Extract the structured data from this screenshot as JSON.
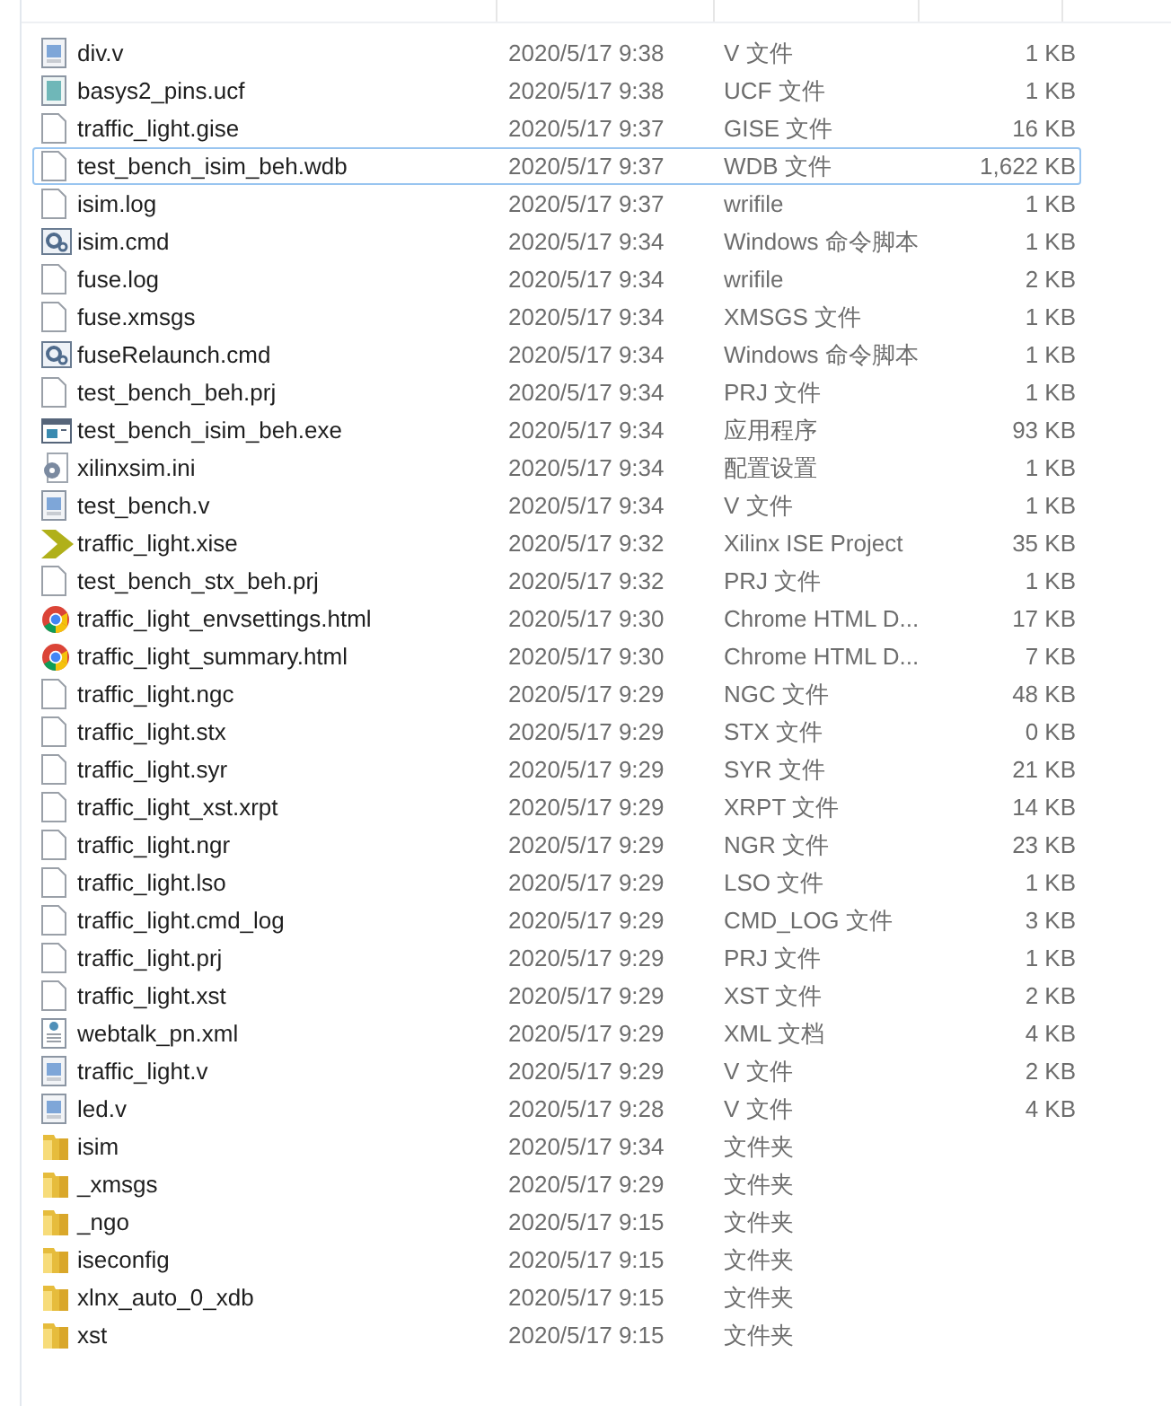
{
  "files": [
    {
      "kind": "source",
      "name": "div.v",
      "date": "2020/5/17 9:38",
      "type": "V 文件",
      "size": "1 KB",
      "selected": false
    },
    {
      "kind": "text",
      "name": "basys2_pins.ucf",
      "date": "2020/5/17 9:38",
      "type": "UCF 文件",
      "size": "1 KB",
      "selected": false
    },
    {
      "kind": "blank",
      "name": "traffic_light.gise",
      "date": "2020/5/17 9:37",
      "type": "GISE 文件",
      "size": "16 KB",
      "selected": false
    },
    {
      "kind": "blank",
      "name": "test_bench_isim_beh.wdb",
      "date": "2020/5/17 9:37",
      "type": "WDB 文件",
      "size": "1,622 KB",
      "selected": true
    },
    {
      "kind": "blank",
      "name": "isim.log",
      "date": "2020/5/17 9:37",
      "type": "wrifile",
      "size": "1 KB",
      "selected": false
    },
    {
      "kind": "script",
      "name": "isim.cmd",
      "date": "2020/5/17 9:34",
      "type": "Windows 命令脚本",
      "size": "1 KB",
      "selected": false
    },
    {
      "kind": "blank",
      "name": "fuse.log",
      "date": "2020/5/17 9:34",
      "type": "wrifile",
      "size": "2 KB",
      "selected": false
    },
    {
      "kind": "blank",
      "name": "fuse.xmsgs",
      "date": "2020/5/17 9:34",
      "type": "XMSGS 文件",
      "size": "1 KB",
      "selected": false
    },
    {
      "kind": "script",
      "name": "fuseRelaunch.cmd",
      "date": "2020/5/17 9:34",
      "type": "Windows 命令脚本",
      "size": "1 KB",
      "selected": false
    },
    {
      "kind": "blank",
      "name": "test_bench_beh.prj",
      "date": "2020/5/17 9:34",
      "type": "PRJ 文件",
      "size": "1 KB",
      "selected": false
    },
    {
      "kind": "program",
      "name": "test_bench_isim_beh.exe",
      "date": "2020/5/17 9:34",
      "type": "应用程序",
      "size": "93 KB",
      "selected": false
    },
    {
      "kind": "settings",
      "name": "xilinxsim.ini",
      "date": "2020/5/17 9:34",
      "type": "配置设置",
      "size": "1 KB",
      "selected": false
    },
    {
      "kind": "source",
      "name": "test_bench.v",
      "date": "2020/5/17 9:34",
      "type": "V 文件",
      "size": "1 KB",
      "selected": false
    },
    {
      "kind": "project",
      "name": "traffic_light.xise",
      "date": "2020/5/17 9:32",
      "type": "Xilinx ISE Project",
      "size": "35 KB",
      "selected": false
    },
    {
      "kind": "blank",
      "name": "test_bench_stx_beh.prj",
      "date": "2020/5/17 9:32",
      "type": "PRJ 文件",
      "size": "1 KB",
      "selected": false
    },
    {
      "kind": "browser",
      "name": "traffic_light_envsettings.html",
      "date": "2020/5/17 9:30",
      "type": "Chrome HTML D...",
      "size": "17 KB",
      "selected": false
    },
    {
      "kind": "browser",
      "name": "traffic_light_summary.html",
      "date": "2020/5/17 9:30",
      "type": "Chrome HTML D...",
      "size": "7 KB",
      "selected": false
    },
    {
      "kind": "blank",
      "name": "traffic_light.ngc",
      "date": "2020/5/17 9:29",
      "type": "NGC 文件",
      "size": "48 KB",
      "selected": false
    },
    {
      "kind": "blank",
      "name": "traffic_light.stx",
      "date": "2020/5/17 9:29",
      "type": "STX 文件",
      "size": "0 KB",
      "selected": false
    },
    {
      "kind": "blank",
      "name": "traffic_light.syr",
      "date": "2020/5/17 9:29",
      "type": "SYR 文件",
      "size": "21 KB",
      "selected": false
    },
    {
      "kind": "blank",
      "name": "traffic_light_xst.xrpt",
      "date": "2020/5/17 9:29",
      "type": "XRPT 文件",
      "size": "14 KB",
      "selected": false
    },
    {
      "kind": "blank",
      "name": "traffic_light.ngr",
      "date": "2020/5/17 9:29",
      "type": "NGR 文件",
      "size": "23 KB",
      "selected": false
    },
    {
      "kind": "blank",
      "name": "traffic_light.lso",
      "date": "2020/5/17 9:29",
      "type": "LSO 文件",
      "size": "1 KB",
      "selected": false
    },
    {
      "kind": "blank",
      "name": "traffic_light.cmd_log",
      "date": "2020/5/17 9:29",
      "type": "CMD_LOG 文件",
      "size": "3 KB",
      "selected": false
    },
    {
      "kind": "blank",
      "name": "traffic_light.prj",
      "date": "2020/5/17 9:29",
      "type": "PRJ 文件",
      "size": "1 KB",
      "selected": false
    },
    {
      "kind": "blank",
      "name": "traffic_light.xst",
      "date": "2020/5/17 9:29",
      "type": "XST 文件",
      "size": "2 KB",
      "selected": false
    },
    {
      "kind": "xml",
      "name": "webtalk_pn.xml",
      "date": "2020/5/17 9:29",
      "type": "XML 文档",
      "size": "4 KB",
      "selected": false
    },
    {
      "kind": "source",
      "name": "traffic_light.v",
      "date": "2020/5/17 9:29",
      "type": "V 文件",
      "size": "2 KB",
      "selected": false
    },
    {
      "kind": "source",
      "name": "led.v",
      "date": "2020/5/17 9:28",
      "type": "V 文件",
      "size": "4 KB",
      "selected": false
    },
    {
      "kind": "folder",
      "name": "isim",
      "date": "2020/5/17 9:34",
      "type": "文件夹",
      "selected": false
    },
    {
      "kind": "folder",
      "name": "_xmsgs",
      "date": "2020/5/17 9:29",
      "type": "文件夹",
      "selected": false
    },
    {
      "kind": "folder",
      "name": "_ngo",
      "date": "2020/5/17 9:15",
      "type": "文件夹",
      "selected": false
    },
    {
      "kind": "folder",
      "name": "iseconfig",
      "date": "2020/5/17 9:15",
      "type": "文件夹",
      "selected": false
    },
    {
      "kind": "folder",
      "name": "xlnx_auto_0_xdb",
      "date": "2020/5/17 9:15",
      "type": "文件夹",
      "selected": false
    },
    {
      "kind": "folder",
      "name": "xst",
      "date": "2020/5/17 9:15",
      "type": "文件夹",
      "selected": false
    }
  ]
}
